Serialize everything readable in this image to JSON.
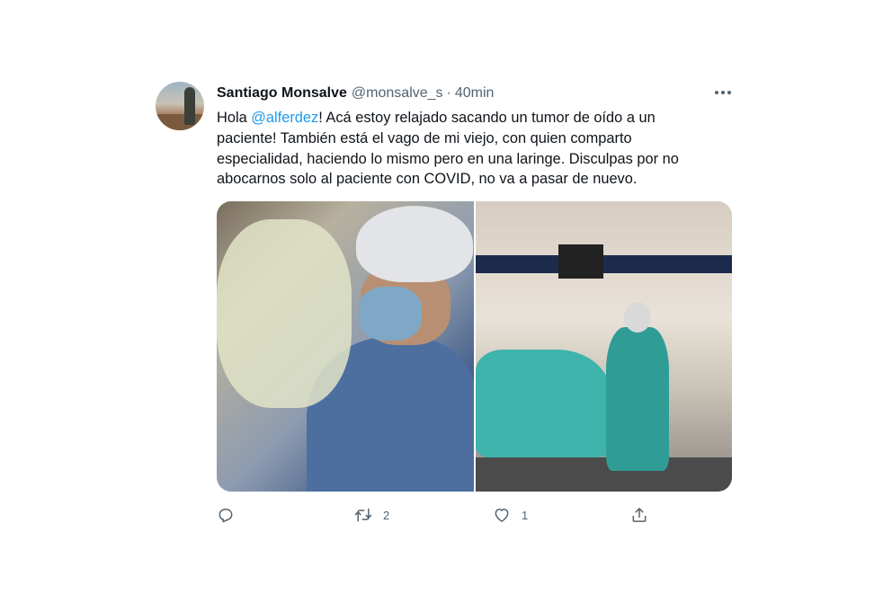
{
  "tweet": {
    "author_name": "Santiago Monsalve",
    "handle": "@monsalve_s",
    "separator": "·",
    "time": "40min",
    "text_before_mention": "Hola ",
    "mention": "@alferdez",
    "text_after_mention": "! Acá estoy relajado sacando un tumor de oído a un paciente! También está el vago de mi viejo, con quien comparto especialidad, haciendo lo mismo pero en una laringe. Disculpas por no abocarnos solo al paciente con COVID, no va a pasar de nuevo.",
    "mention_color": "#1d9bf0"
  },
  "actions": {
    "reply_count": "",
    "retweet_count": "2",
    "like_count": "1",
    "icons": [
      "reply-icon",
      "retweet-icon",
      "like-icon",
      "share-icon"
    ]
  }
}
